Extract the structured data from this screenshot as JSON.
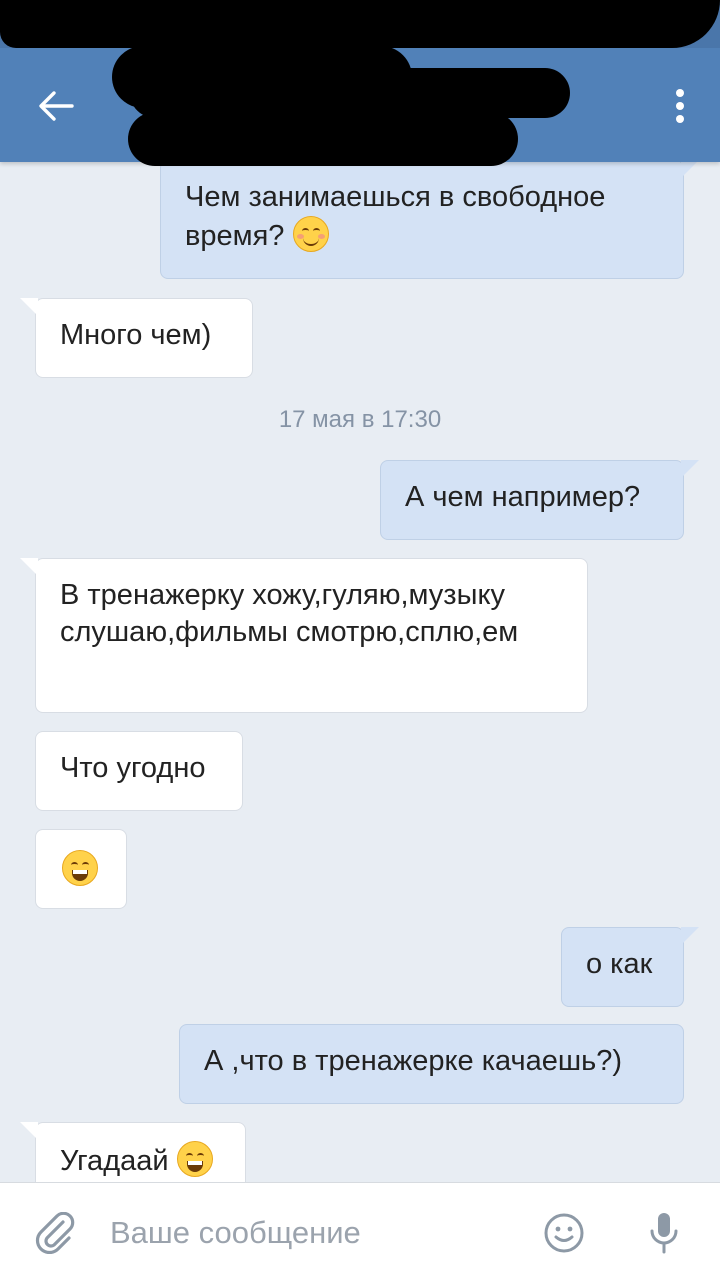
{
  "header": {
    "title": "",
    "back_icon": "arrow-left-icon",
    "more_icon": "more-vertical-icon"
  },
  "messages": [
    {
      "side": "out",
      "text": "Чем занимаешься в свободное время?",
      "emoji": "smiling-blush"
    },
    {
      "side": "in",
      "text": "Много чем)"
    },
    {
      "side": "in",
      "text": "В тренажерку хожу,гуляю,музыку слушаю,фильмы смотрю,сплю,ем"
    },
    {
      "side": "out",
      "text": "А чем например?"
    },
    {
      "side": "in",
      "text": "Что угодно"
    },
    {
      "side": "in",
      "text": "",
      "emoji": "grinning"
    },
    {
      "side": "out",
      "text": "о как"
    },
    {
      "side": "out",
      "text": "А ,что в тренажерке качаешь?)"
    },
    {
      "side": "in",
      "text": "Угадаай",
      "emoji": "grinning"
    }
  ],
  "date_separator": "17 мая в 17:30",
  "input": {
    "placeholder": "Ваше сообщение",
    "value": "",
    "attach_icon": "paperclip-icon",
    "emoji_icon": "smiley-icon",
    "mic_icon": "microphone-icon"
  },
  "colors": {
    "header": "#5181b8",
    "background": "#e8edf3",
    "outgoing_bubble": "#d4e2f5",
    "incoming_bubble": "#ffffff"
  }
}
